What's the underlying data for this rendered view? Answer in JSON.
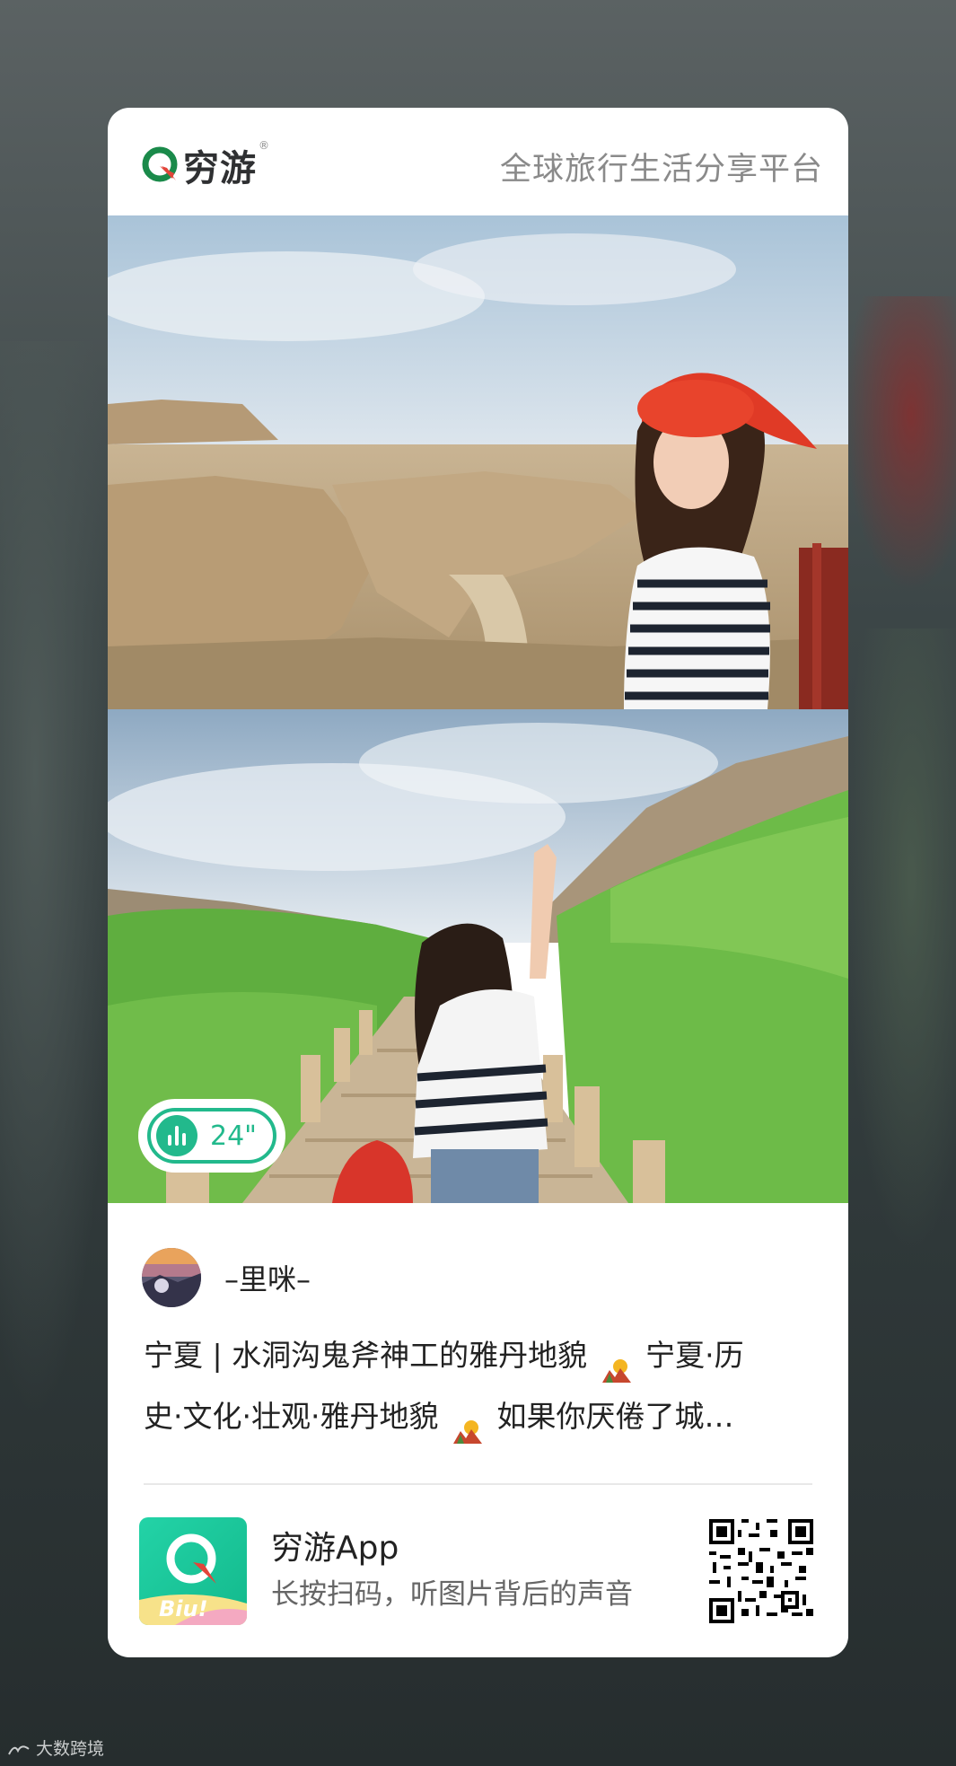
{
  "header": {
    "brand_name": "穷游",
    "brand_reg": "®",
    "slogan": "全球旅行生活分享平台"
  },
  "audio": {
    "duration": "24\""
  },
  "author": {
    "name": "–里咪–"
  },
  "post": {
    "line1": "宁夏 | 水洞沟鬼斧神工的雅丹地貌 ",
    "line1_tail": " 宁夏·历",
    "line2": "史·文化·壮观·雅丹地貌 ",
    "line2_tail": " 如果你厌倦了城…",
    "emoji": "desert-icon"
  },
  "app": {
    "title": "穷游App",
    "subtitle": "长按扫码，听图片背后的声音",
    "icon_label": "Biu!"
  },
  "watermark": "大数跨境",
  "colors": {
    "accent": "#22b98c",
    "brand_green": "#1a8a4a",
    "brand_red": "#e2453a"
  }
}
